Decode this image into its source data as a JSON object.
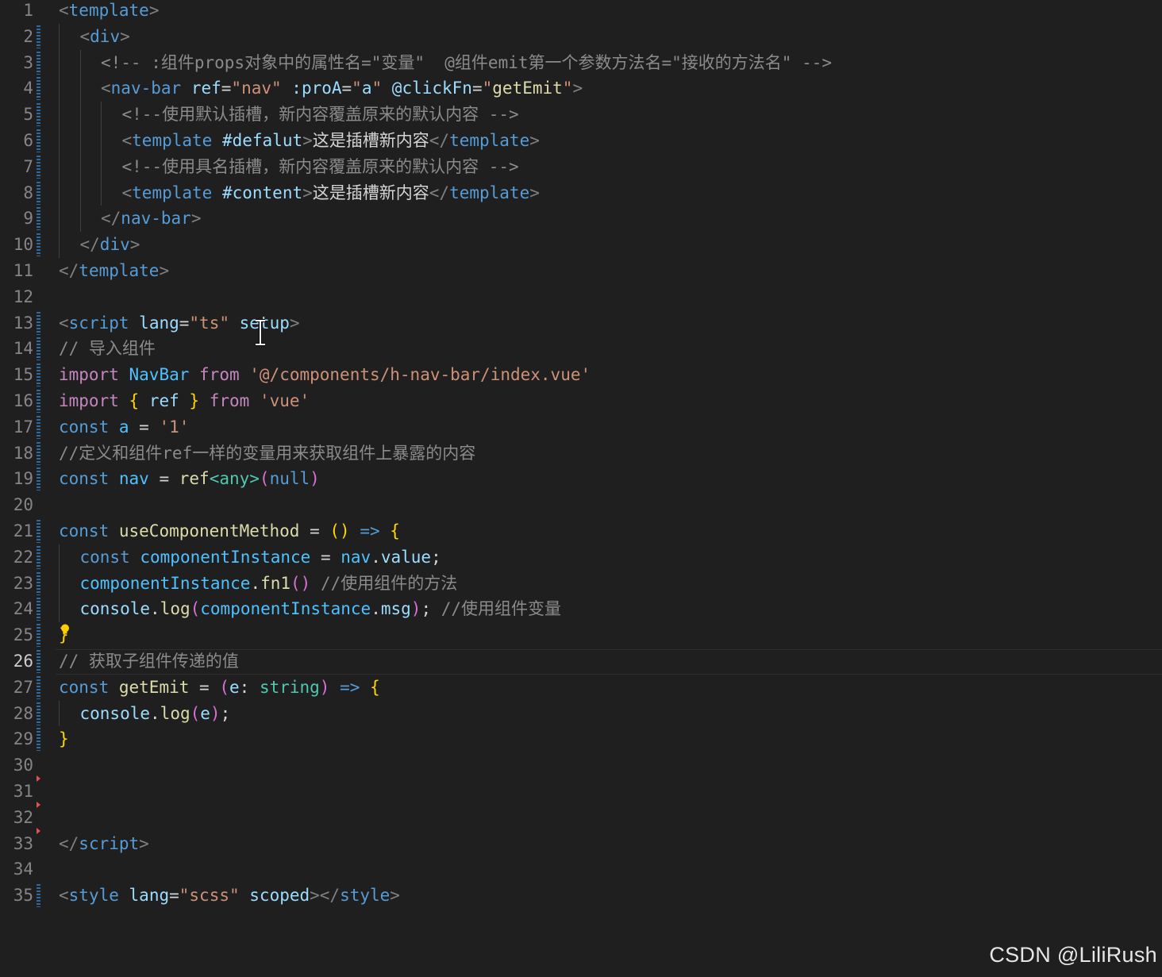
{
  "editor": {
    "active_line": 26,
    "lines": [
      {
        "n": 1,
        "indent": 0,
        "tokens": [
          [
            "tag-b",
            "<"
          ],
          [
            "tag",
            "template"
          ],
          [
            "tag-b",
            ">"
          ]
        ]
      },
      {
        "n": 2,
        "indent": 1,
        "tokens": [
          [
            "tag-b",
            "<"
          ],
          [
            "tag",
            "div"
          ],
          [
            "tag-b",
            ">"
          ]
        ]
      },
      {
        "n": 3,
        "indent": 2,
        "tokens": [
          [
            "cm-g",
            "<!-- :组件props对象中的属性名=\"变量\"  @组件emit第一个参数方法名=\"接收的方法名\" -->"
          ]
        ]
      },
      {
        "n": 4,
        "indent": 2,
        "tokens": [
          [
            "tag-b",
            "<"
          ],
          [
            "tag",
            "nav-bar"
          ],
          [
            "plain",
            " "
          ],
          [
            "attr",
            "ref"
          ],
          [
            "plain",
            "="
          ],
          [
            "str",
            "\"nav\""
          ],
          [
            "plain",
            " "
          ],
          [
            "attr",
            ":proA"
          ],
          [
            "plain",
            "="
          ],
          [
            "str",
            "\""
          ],
          [
            "attr",
            "a"
          ],
          [
            "str",
            "\""
          ],
          [
            "plain",
            " "
          ],
          [
            "attr",
            "@clickFn"
          ],
          [
            "plain",
            "="
          ],
          [
            "str",
            "\""
          ],
          [
            "fn",
            "getEmit"
          ],
          [
            "str",
            "\""
          ],
          [
            "tag-b",
            ">"
          ]
        ]
      },
      {
        "n": 5,
        "indent": 3,
        "tokens": [
          [
            "cm-g",
            "<!--使用默认插槽，新内容覆盖原来的默认内容 -->"
          ]
        ]
      },
      {
        "n": 6,
        "indent": 3,
        "tokens": [
          [
            "tag-b",
            "<"
          ],
          [
            "tag",
            "template"
          ],
          [
            "plain",
            " "
          ],
          [
            "attr",
            "#defalut"
          ],
          [
            "tag-b",
            ">"
          ],
          [
            "plain",
            "这是插槽新内容"
          ],
          [
            "tag-b",
            "</"
          ],
          [
            "tag",
            "template"
          ],
          [
            "tag-b",
            ">"
          ]
        ]
      },
      {
        "n": 7,
        "indent": 3,
        "tokens": [
          [
            "cm-g",
            "<!--使用具名插槽，新内容覆盖原来的默认内容 -->"
          ]
        ]
      },
      {
        "n": 8,
        "indent": 3,
        "tokens": [
          [
            "tag-b",
            "<"
          ],
          [
            "tag",
            "template"
          ],
          [
            "plain",
            " "
          ],
          [
            "attr",
            "#content"
          ],
          [
            "tag-b",
            ">"
          ],
          [
            "plain",
            "这是插槽新内容"
          ],
          [
            "tag-b",
            "</"
          ],
          [
            "tag",
            "template"
          ],
          [
            "tag-b",
            ">"
          ]
        ]
      },
      {
        "n": 9,
        "indent": 2,
        "tokens": [
          [
            "tag-b",
            "</"
          ],
          [
            "tag",
            "nav-bar"
          ],
          [
            "tag-b",
            ">"
          ]
        ]
      },
      {
        "n": 10,
        "indent": 1,
        "tokens": [
          [
            "tag-b",
            "</"
          ],
          [
            "tag",
            "div"
          ],
          [
            "tag-b",
            ">"
          ]
        ]
      },
      {
        "n": 11,
        "indent": 0,
        "tokens": [
          [
            "tag-b",
            "</"
          ],
          [
            "tag",
            "template"
          ],
          [
            "tag-b",
            ">"
          ]
        ]
      },
      {
        "n": 12,
        "indent": 0,
        "tokens": []
      },
      {
        "n": 13,
        "indent": 0,
        "tokens": [
          [
            "tag-b",
            "<"
          ],
          [
            "tag",
            "script"
          ],
          [
            "plain",
            " "
          ],
          [
            "attr",
            "lang"
          ],
          [
            "plain",
            "="
          ],
          [
            "str",
            "\"ts\""
          ],
          [
            "plain",
            " "
          ],
          [
            "attr",
            "setup"
          ],
          [
            "tag-b",
            ">"
          ]
        ]
      },
      {
        "n": 14,
        "indent": 0,
        "tokens": [
          [
            "cm-g",
            "// 导入组件"
          ]
        ]
      },
      {
        "n": 15,
        "indent": 0,
        "tokens": [
          [
            "kw",
            "import"
          ],
          [
            "plain",
            " "
          ],
          [
            "var",
            "NavBar"
          ],
          [
            "plain",
            " "
          ],
          [
            "kw",
            "from"
          ],
          [
            "plain",
            " "
          ],
          [
            "str",
            "'@/components/h-nav-bar/index.vue'"
          ]
        ]
      },
      {
        "n": 16,
        "indent": 0,
        "tokens": [
          [
            "kw",
            "import"
          ],
          [
            "plain",
            " "
          ],
          [
            "br1",
            "{"
          ],
          [
            "plain",
            " "
          ],
          [
            "prop",
            "ref"
          ],
          [
            "plain",
            " "
          ],
          [
            "br1",
            "}"
          ],
          [
            "plain",
            " "
          ],
          [
            "kw",
            "from"
          ],
          [
            "plain",
            " "
          ],
          [
            "str",
            "'vue'"
          ]
        ]
      },
      {
        "n": 17,
        "indent": 0,
        "tokens": [
          [
            "kwb",
            "const"
          ],
          [
            "plain",
            " "
          ],
          [
            "var",
            "a"
          ],
          [
            "plain",
            " = "
          ],
          [
            "str",
            "'1'"
          ]
        ]
      },
      {
        "n": 18,
        "indent": 0,
        "tokens": [
          [
            "cm-g",
            "//定义和组件ref一样的变量用来获取组件上暴露的内容"
          ]
        ]
      },
      {
        "n": 19,
        "indent": 0,
        "tokens": [
          [
            "kwb",
            "const"
          ],
          [
            "plain",
            " "
          ],
          [
            "var",
            "nav"
          ],
          [
            "plain",
            " = "
          ],
          [
            "fn",
            "ref"
          ],
          [
            "ty",
            "<any>"
          ],
          [
            "br2",
            "("
          ],
          [
            "kwb",
            "null"
          ],
          [
            "br2",
            ")"
          ]
        ]
      },
      {
        "n": 20,
        "indent": 0,
        "tokens": []
      },
      {
        "n": 21,
        "indent": 0,
        "tokens": [
          [
            "kwb",
            "const"
          ],
          [
            "plain",
            " "
          ],
          [
            "fn",
            "useComponentMethod"
          ],
          [
            "plain",
            " = "
          ],
          [
            "br1",
            "()"
          ],
          [
            "plain",
            " "
          ],
          [
            "kwb",
            "=>"
          ],
          [
            "plain",
            " "
          ],
          [
            "br1",
            "{"
          ]
        ]
      },
      {
        "n": 22,
        "indent": 1,
        "tokens": [
          [
            "kwb",
            "const"
          ],
          [
            "plain",
            " "
          ],
          [
            "var",
            "componentInstance"
          ],
          [
            "plain",
            " = "
          ],
          [
            "var",
            "nav"
          ],
          [
            "plain",
            "."
          ],
          [
            "prop",
            "value"
          ],
          [
            "plain",
            ";"
          ]
        ]
      },
      {
        "n": 23,
        "indent": 1,
        "tokens": [
          [
            "var",
            "componentInstance"
          ],
          [
            "plain",
            "."
          ],
          [
            "fn",
            "fn1"
          ],
          [
            "br2",
            "()"
          ],
          [
            "plain",
            " "
          ],
          [
            "cm-g",
            "//使用组件的方法"
          ]
        ]
      },
      {
        "n": 24,
        "indent": 1,
        "tokens": [
          [
            "prop",
            "console"
          ],
          [
            "plain",
            "."
          ],
          [
            "fn",
            "log"
          ],
          [
            "br2",
            "("
          ],
          [
            "var",
            "componentInstance"
          ],
          [
            "plain",
            "."
          ],
          [
            "prop",
            "msg"
          ],
          [
            "br2",
            ")"
          ],
          [
            "plain",
            "; "
          ],
          [
            "cm-g",
            "//使用组件变量"
          ]
        ]
      },
      {
        "n": 25,
        "indent": 0,
        "tokens": [
          [
            "br1",
            "}"
          ]
        ]
      },
      {
        "n": 26,
        "indent": 0,
        "tokens": [
          [
            "cm-g",
            "// 获取子组件传递的值"
          ]
        ]
      },
      {
        "n": 27,
        "indent": 0,
        "tokens": [
          [
            "kwb",
            "const"
          ],
          [
            "plain",
            " "
          ],
          [
            "fn",
            "getEmit"
          ],
          [
            "plain",
            " = "
          ],
          [
            "br2",
            "("
          ],
          [
            "prop",
            "e"
          ],
          [
            "plain",
            ": "
          ],
          [
            "ty",
            "string"
          ],
          [
            "br2",
            ")"
          ],
          [
            "plain",
            " "
          ],
          [
            "kwb",
            "=>"
          ],
          [
            "plain",
            " "
          ],
          [
            "br1",
            "{"
          ]
        ]
      },
      {
        "n": 28,
        "indent": 1,
        "tokens": [
          [
            "prop",
            "console"
          ],
          [
            "plain",
            "."
          ],
          [
            "fn",
            "log"
          ],
          [
            "br2",
            "("
          ],
          [
            "prop",
            "e"
          ],
          [
            "br2",
            ")"
          ],
          [
            "plain",
            ";"
          ]
        ]
      },
      {
        "n": 29,
        "indent": 0,
        "tokens": [
          [
            "br1",
            "}"
          ]
        ]
      },
      {
        "n": 30,
        "indent": 0,
        "tokens": []
      },
      {
        "n": 31,
        "indent": 0,
        "tokens": []
      },
      {
        "n": 32,
        "indent": 0,
        "tokens": []
      },
      {
        "n": 33,
        "indent": 0,
        "tokens": [
          [
            "tag-b",
            "</"
          ],
          [
            "tag",
            "script"
          ],
          [
            "tag-b",
            ">"
          ]
        ]
      },
      {
        "n": 34,
        "indent": 0,
        "tokens": []
      },
      {
        "n": 35,
        "indent": 0,
        "tokens": [
          [
            "tag-b",
            "<"
          ],
          [
            "tag",
            "style"
          ],
          [
            "plain",
            " "
          ],
          [
            "attr",
            "lang"
          ],
          [
            "plain",
            "="
          ],
          [
            "str",
            "\"scss\""
          ],
          [
            "plain",
            " "
          ],
          [
            "attr",
            "scoped"
          ],
          [
            "tag-b",
            "></"
          ],
          [
            "tag",
            "style"
          ],
          [
            "tag-b",
            ">"
          ]
        ]
      }
    ],
    "modified_lines": [
      2,
      3,
      4,
      5,
      6,
      7,
      8,
      9,
      10,
      13,
      14,
      15,
      16,
      17,
      18,
      19,
      21,
      22,
      23,
      24,
      25,
      26,
      27,
      28,
      29,
      35
    ],
    "deleted_markers_after": [
      30,
      31,
      32
    ]
  },
  "icons": {
    "lightbulb": "lightbulb-icon",
    "text_cursor": "text-cursor-icon"
  },
  "colors": {
    "background": "#1f1f1f",
    "line_number": "#858585",
    "active_line_number": "#cccccc",
    "modified_gutter": "#2f6a9e",
    "deleted_marker": "#e05252"
  },
  "watermark": "CSDN @LiliRush"
}
